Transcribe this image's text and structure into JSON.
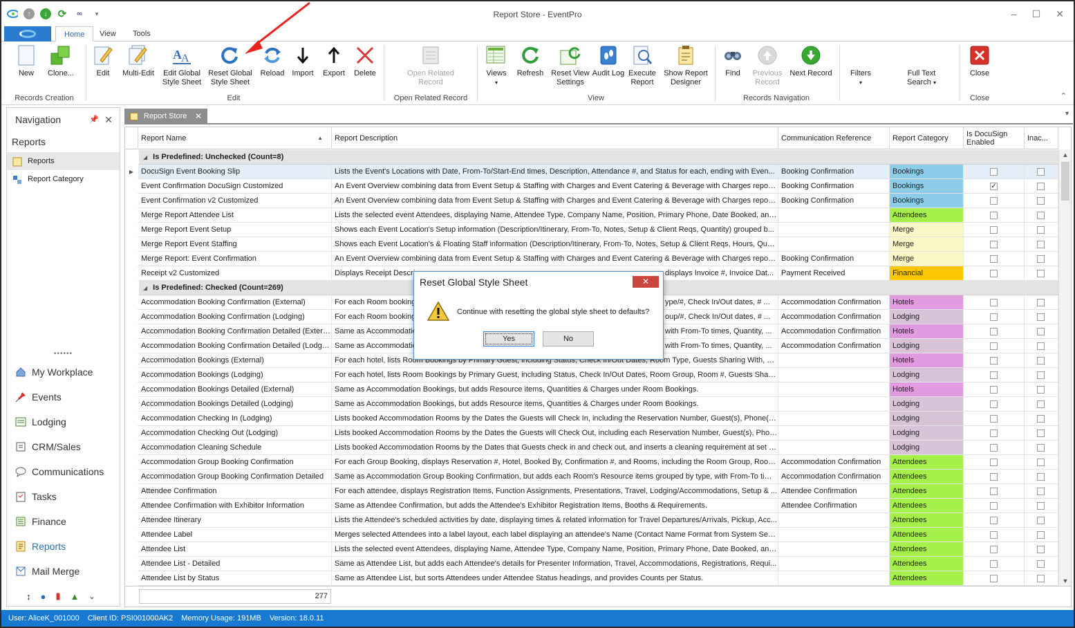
{
  "window": {
    "title": "Report Store - EventPro"
  },
  "ribbon": {
    "tabs": [
      "Home",
      "View",
      "Tools"
    ],
    "active_tab": "Home",
    "groups": {
      "records_creation": {
        "label": "Records Creation",
        "new": "New",
        "clone": "Clone..."
      },
      "edit": {
        "label": "Edit",
        "edit": "Edit",
        "multi_edit": "Multi-Edit",
        "edit_global": "Edit Global Style Sheet",
        "reset_global": "Reset Global Style Sheet",
        "reload": "Reload",
        "import": "Import",
        "export": "Export",
        "delete": "Delete"
      },
      "open_related": {
        "label": "Open Related Record",
        "btn": "Open Related Record"
      },
      "view": {
        "label": "View",
        "views": "Views",
        "refresh": "Refresh",
        "reset_view": "Reset View Settings",
        "audit_log": "Audit Log",
        "execute_report": "Execute Report",
        "show_designer": "Show Report Designer"
      },
      "records_navigation": {
        "label": "Records Navigation",
        "find": "Find",
        "previous": "Previous Record",
        "next": "Next Record",
        "filters": "Filters",
        "full_text": "Full Text Search"
      },
      "close": {
        "label": "Close",
        "btn": "Close"
      }
    }
  },
  "nav": {
    "title": "Navigation",
    "section": "Reports",
    "items": [
      "Reports",
      "Report Category"
    ],
    "modules": [
      "My Workplace",
      "Events",
      "Lodging",
      "CRM/Sales",
      "Communications",
      "Tasks",
      "Finance",
      "Reports",
      "Mail Merge"
    ],
    "selected_module": "Reports"
  },
  "doc_tab": {
    "label": "Report Store"
  },
  "grid": {
    "columns": [
      "Report Name",
      "Report Description",
      "Communication Reference",
      "Report Category",
      "Is DocuSign Enabled",
      "Inac..."
    ],
    "groups": [
      {
        "label": "Is Predefined: Unchecked (Count=8)",
        "rows": [
          {
            "name": "DocuSign Event Booking Slip",
            "desc": "Lists the Event's Locations with Date, From-To/Start-End times, Description, Attendance #, and Status for each, ending with Even...",
            "comm": "Booking Confirmation",
            "cat": "Bookings",
            "docusign": false,
            "selected": true
          },
          {
            "name": "Event Confirmation DocuSign Customized",
            "desc": "An Event Overview combining data from Event Setup & Staffing with Charges and Event Catering & Beverage with Charges report...",
            "comm": "Booking Confirmation",
            "cat": "Bookings",
            "docusign": true
          },
          {
            "name": "Event Confirmation v2 Customized",
            "desc": "An Event Overview combining data from Event Setup & Staffing with Charges and Event Catering & Beverage with Charges report...",
            "comm": "Booking Confirmation",
            "cat": "Bookings",
            "docusign": false
          },
          {
            "name": "Merge Report Attendee List",
            "desc": "Lists the selected event Attendees, displaying Name, Attendee Type, Company Name, Position, Primary Phone, Date Booked, and...",
            "comm": "",
            "cat": "Attendees",
            "docusign": false
          },
          {
            "name": "Merge Report Event Setup",
            "desc": "Shows each Event Location's Setup information (Description/Itinerary, From-To, Notes, Setup & Client Reqs, Quantity) grouped b...",
            "comm": "",
            "cat": "Merge",
            "docusign": false
          },
          {
            "name": "Merge Report Event Staffing",
            "desc": "Shows each Event Location's & Floating Staff information (Description/Itinerary, From-To, Notes, Setup & Client Reqs, Hours, Qua...",
            "comm": "",
            "cat": "Merge",
            "docusign": false
          },
          {
            "name": "Merge Report: Event Confirmation",
            "desc": "An Event Overview combining data from Event Setup & Staffing with Charges and Event Catering & Beverage with Charges report...",
            "comm": "Booking Confirmation",
            "cat": "Merge",
            "docusign": false
          },
          {
            "name": "Receipt v2 Customized",
            "desc": "Displays Receipt Descrip",
            "desc_right": "displays Invoice #, Invoice Dat...",
            "comm": "Payment Received",
            "cat": "Financial",
            "docusign": false
          }
        ]
      },
      {
        "label": "Is Predefined: Checked (Count=269)",
        "rows": [
          {
            "name": "Accommodation Booking Confirmation (External)",
            "desc": "For each Room booking,",
            "desc_right": "ype/#, Check In/Out dates, # ...",
            "comm": "Accommodation Confirmation",
            "cat": "Hotels",
            "docusign": false
          },
          {
            "name": "Accommodation Booking Confirmation (Lodging)",
            "desc": "For each Room booking,",
            "desc_right": "oup/#, Check In/Out dates, # ...",
            "comm": "Accommodation Confirmation",
            "cat": "Lodging",
            "docusign": false
          },
          {
            "name": "Accommodation Booking Confirmation Detailed (External)",
            "desc": "Same as Accommodation",
            "desc_right": "with From-To times, Quantity, ...",
            "comm": "Accommodation Confirmation",
            "cat": "Hotels",
            "docusign": false
          },
          {
            "name": "Accommodation Booking Confirmation Detailed (Lodging)",
            "desc": "Same as Accommodation",
            "desc_right": "with From-To times, Quantity, ...",
            "comm": "Accommodation Confirmation",
            "cat": "Lodging",
            "docusign": false
          },
          {
            "name": "Accommodation Bookings (External)",
            "desc": "For each hotel, lists Room Bookings by Primary Guest, including Status, Check In/Out Dates, Room Type, Guests Sharing With, # ...",
            "comm": "",
            "cat": "Hotels",
            "docusign": false
          },
          {
            "name": "Accommodation Bookings (Lodging)",
            "desc": "For each hotel, lists Room Bookings by Primary Guest, including Status, Check In/Out Dates, Room Group, Room #, Guests Sharin...",
            "comm": "",
            "cat": "Lodging",
            "docusign": false
          },
          {
            "name": "Accommodation Bookings Detailed (External)",
            "desc": "Same as Accommodation Bookings, but adds Resource items, Quantities & Charges under Room Bookings.",
            "comm": "",
            "cat": "Hotels",
            "docusign": false
          },
          {
            "name": "Accommodation Bookings Detailed (Lodging)",
            "desc": "Same as Accommodation Bookings, but adds Resource items, Quantities & Charges under Room Bookings.",
            "comm": "",
            "cat": "Lodging",
            "docusign": false
          },
          {
            "name": "Accommodation Checking In (Lodging)",
            "desc": "Lists booked Accommodation Rooms by the Dates the Guests will Check In, including the Reservation Number, Guest(s), Phone(s),...",
            "comm": "",
            "cat": "Lodging",
            "docusign": false
          },
          {
            "name": "Accommodation Checking Out (Lodging)",
            "desc": "Lists booked Accommodation Rooms by the Dates the Guests will Check Out, including each Reservation Number, Guest(s), Phone(...",
            "comm": "",
            "cat": "Lodging",
            "docusign": false
          },
          {
            "name": "Accommodation Cleaning Schedule",
            "desc": "Lists booked Accommodation Rooms by the Dates that Guests check in and check out, and inserts a cleaning requirement at set int...",
            "comm": "",
            "cat": "Lodging",
            "docusign": false
          },
          {
            "name": "Accommodation Group Booking Confirmation",
            "desc": "For each Group Booking, displays Reservation #, Hotel, Booked By, Confirmation #, and Rooms, including the Room Group, Room ...",
            "comm": "Accommodation Confirmation",
            "cat": "Attendees",
            "docusign": false
          },
          {
            "name": "Accommodation Group Booking Confirmation Detailed",
            "desc": "Same as Accommodation Group Booking Confirmation, but adds each Room's Resource items grouped by type, with From-To times...",
            "comm": "Accommodation Confirmation",
            "cat": "Attendees",
            "docusign": false
          },
          {
            "name": "Attendee Confirmation",
            "desc": "For each attendee, displays Registration Items, Function Assignments, Presentations, Travel, Lodging/Accommodations, Setup & ...",
            "comm": "Attendee Confirmation",
            "cat": "Attendees",
            "docusign": false
          },
          {
            "name": "Attendee Confirmation with Exhibitor Information",
            "desc": "Same as Attendee Confirmation, but adds the Attendee's Exhibitor Registration Items, Booths & Requirements.",
            "comm": "Attendee Confirmation",
            "cat": "Attendees",
            "docusign": false
          },
          {
            "name": "Attendee Itinerary",
            "desc": "Lists the Attendee's scheduled activities by date, displaying times & related information for Travel Departures/Arrivals, Pickup, Acc...",
            "comm": "",
            "cat": "Attendees",
            "docusign": false
          },
          {
            "name": "Attendee Label",
            "desc": "Merges selected Attendees into a label layout, each label displaying an attendee's Name (Contact Name Format from System Setti...",
            "comm": "",
            "cat": "Attendees",
            "docusign": false
          },
          {
            "name": "Attendee List",
            "desc": "Lists the selected event Attendees, displaying Name, Attendee Type, Company Name, Position, Primary Phone, Date Booked, and...",
            "comm": "",
            "cat": "Attendees",
            "docusign": false
          },
          {
            "name": "Attendee List - Detailed",
            "desc": "Same as Attendee List, but adds each Attendee's details for Presenter Information, Travel, Accommodations, Registrations, Requi...",
            "comm": "",
            "cat": "Attendees",
            "docusign": false
          },
          {
            "name": "Attendee List by Status",
            "desc": "Same as Attendee List, but sorts Attendees under Attendee Status headings, and provides Counts per Status.",
            "comm": "",
            "cat": "Attendees",
            "docusign": false
          }
        ]
      }
    ],
    "category_colors": {
      "Bookings": "#8ecdea",
      "Attendees": "#a6f04a",
      "Merge": "#fbf8c8",
      "Financial": "#fbc700",
      "Hotels": "#e29be0",
      "Lodging": "#d8c3d8"
    },
    "record_count": "277"
  },
  "dialog": {
    "title": "Reset Global Style Sheet",
    "message": "Continue with resetting the global style sheet to defaults?",
    "yes": "Yes",
    "no": "No"
  },
  "status_bar": {
    "user": "User: AliceK_001000",
    "client": "Client ID: PSI001000AK2",
    "memory": "Memory Usage: 191MB",
    "version": "Version: 18.0.11"
  }
}
